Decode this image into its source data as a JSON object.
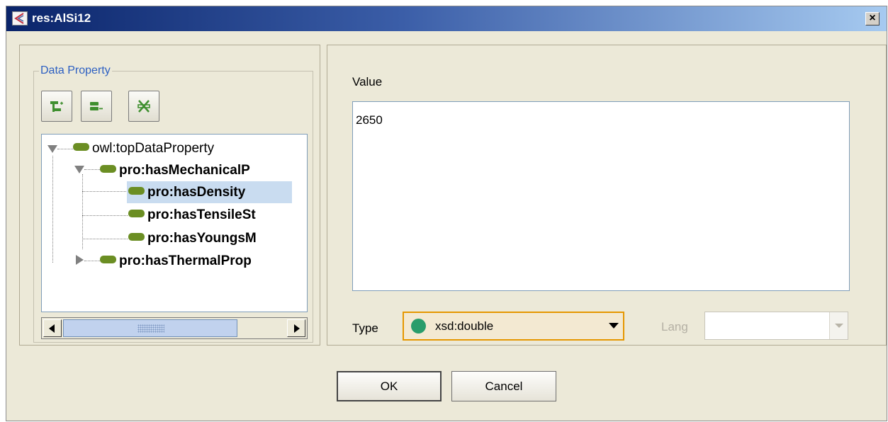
{
  "window": {
    "title": "res:AlSi12",
    "close_glyph": "×",
    "icon": "protege-icon"
  },
  "left_panel": {
    "group_title": "Data Property",
    "toolbar": [
      {
        "icon": "add-subproperty-icon",
        "color": "#3f8f2f"
      },
      {
        "icon": "add-sibling-property-icon",
        "color": "#3f8f2f"
      },
      {
        "icon": "delete-property-icon",
        "color": "#3f8f2f"
      }
    ],
    "tree": [
      {
        "label": "owl:topDataProperty",
        "level": 0,
        "expanded": true,
        "bold": false
      },
      {
        "label": "pro:hasMechanicalP",
        "level": 1,
        "expanded": true,
        "bold": true
      },
      {
        "label": "pro:hasDensity",
        "level": 2,
        "selected": true,
        "bold": true
      },
      {
        "label": "pro:hasTensileSt",
        "level": 2,
        "bold": true
      },
      {
        "label": "pro:hasYoungsM",
        "level": 2,
        "bold": true
      },
      {
        "label": "pro:hasThermalProp",
        "level": 1,
        "expanded": false,
        "bold": true
      }
    ]
  },
  "right_panel": {
    "value_label": "Value",
    "value": "2650",
    "type_label": "Type",
    "type_value": "xsd:double",
    "lang_label": "Lang",
    "lang_value": ""
  },
  "buttons": {
    "ok": "OK",
    "cancel": "Cancel"
  },
  "colors": {
    "accent": "#e59700",
    "selection": "#c9dcf0",
    "property_pill": "#6b8e23",
    "group_title": "#2c5fc2"
  }
}
